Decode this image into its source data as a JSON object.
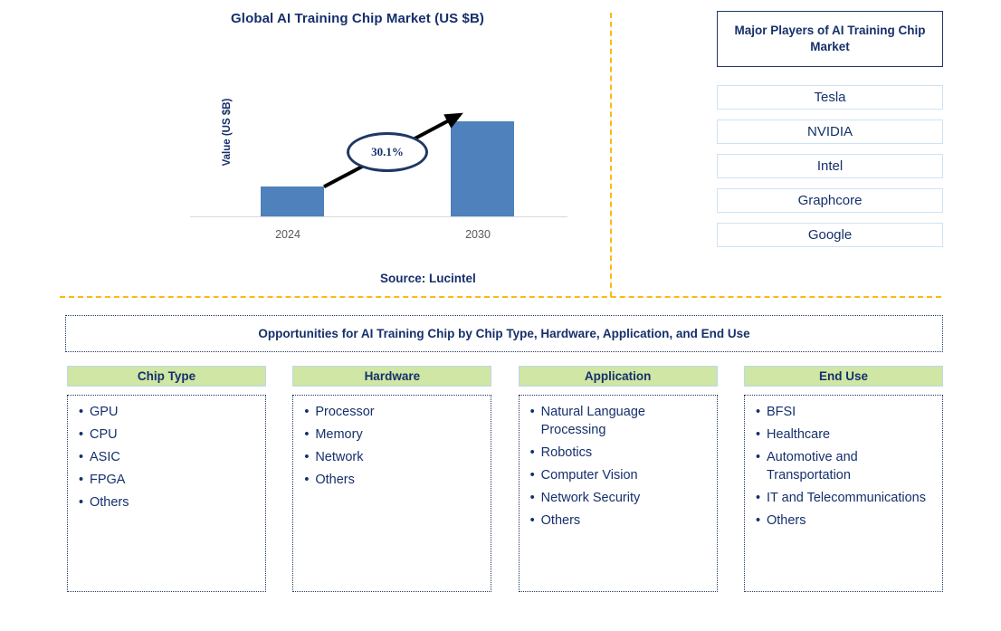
{
  "chart_panel": {
    "title": "Global AI Training Chip Market (US $B)",
    "y_axis_label": "Value (US $B)",
    "cagr_badge": "30.1%",
    "source": "Source: Lucintel"
  },
  "chart_data": {
    "type": "bar",
    "title": "Global AI Training Chip Market (US $B)",
    "categories": [
      "2024",
      "2030"
    ],
    "values": [
      33,
      105
    ],
    "xlabel": "",
    "ylabel": "Value (US $B)",
    "ylim": [
      0,
      120
    ],
    "grid": false,
    "legend": "none",
    "bar_color": "#4f81bd",
    "annotations": [
      {
        "text": "30.1%",
        "kind": "cagr-callout",
        "from": "2024",
        "to": "2030"
      }
    ]
  },
  "players_panel": {
    "header": "Major Players of AI Training Chip Market",
    "items": [
      "Tesla",
      "NVIDIA",
      "Intel",
      "Graphcore",
      "Google"
    ]
  },
  "opportunities": {
    "banner": "Opportunities for AI Training Chip by Chip Type, Hardware, Application, and End Use",
    "columns": [
      {
        "header": "Chip Type",
        "items": [
          "GPU",
          "CPU",
          "ASIC",
          "FPGA",
          "Others"
        ]
      },
      {
        "header": "Hardware",
        "items": [
          "Processor",
          "Memory",
          "Network",
          "Others"
        ]
      },
      {
        "header": "Application",
        "items": [
          "Natural Language Processing",
          "Robotics",
          "Computer Vision",
          "Network Security",
          "Others"
        ]
      },
      {
        "header": "End Use",
        "items": [
          "BFSI",
          "Healthcare",
          "Automotive and Transportation",
          "IT and Telecommunications",
          "Others"
        ]
      }
    ]
  },
  "colors": {
    "navy": "#15306b",
    "bar_blue": "#4f81bd",
    "header_green": "#cfe6a4",
    "divider_orange": "#fcb913",
    "box_border_light_blue": "#cfe2f3"
  }
}
